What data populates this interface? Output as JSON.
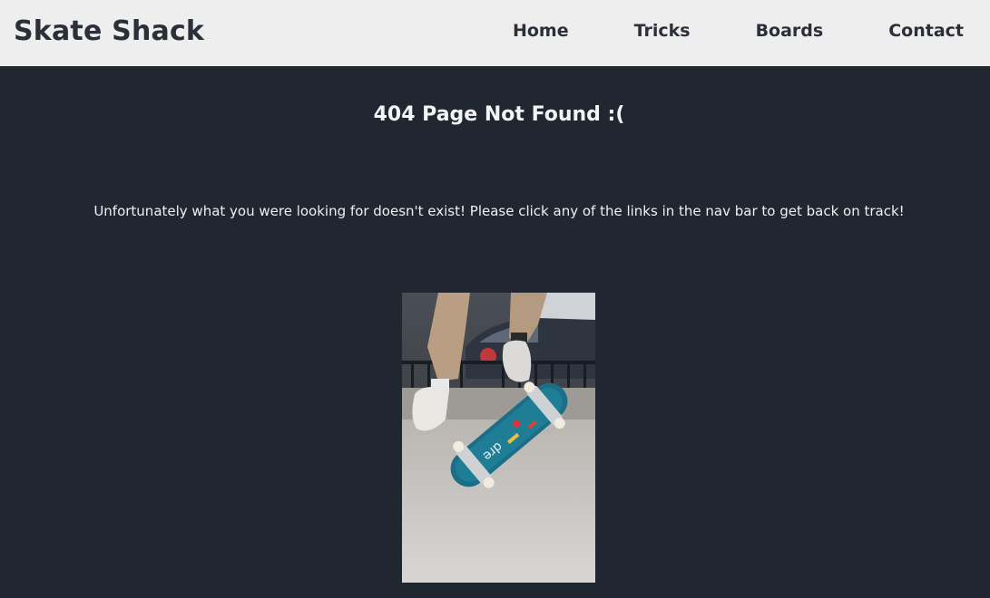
{
  "nav": {
    "brand": "Skate Shack",
    "links": [
      {
        "label": "Home"
      },
      {
        "label": "Tricks"
      },
      {
        "label": "Boards"
      },
      {
        "label": "Contact"
      }
    ]
  },
  "main": {
    "title": "404 Page Not Found :(",
    "message": "Unfortunately what you were looking for doesn't exist! Please click any of the links in the nav bar to get back on track!",
    "image": {
      "board_text": "dre"
    }
  },
  "colors": {
    "page_bg": "#212731",
    "nav_bg": "#eeeeee",
    "nav_text": "#2a2f38",
    "body_text": "#eef0f2",
    "board_color": "#1a6e86"
  }
}
